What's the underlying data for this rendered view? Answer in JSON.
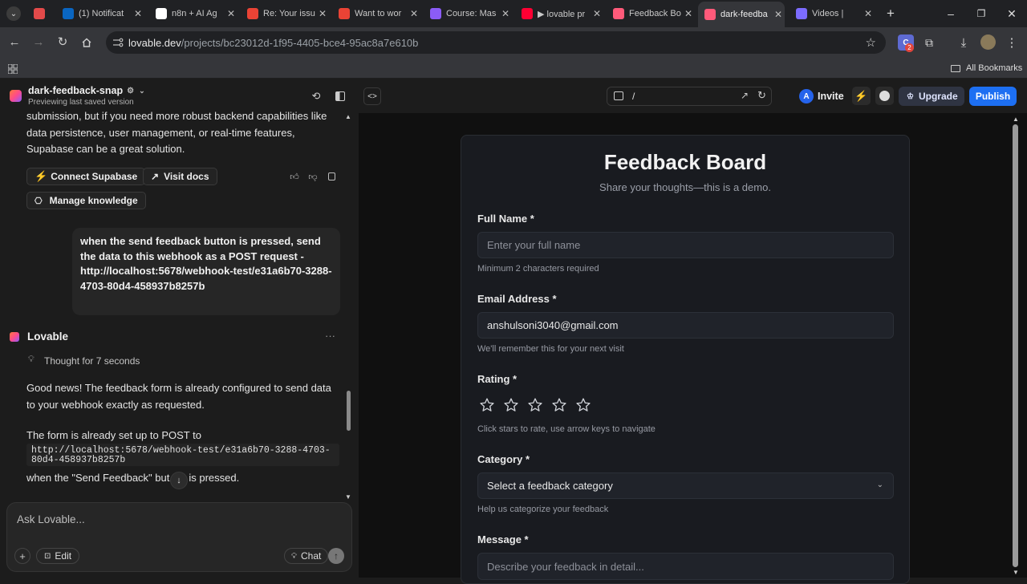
{
  "browser": {
    "tabs": [
      {
        "title": "",
        "favicon": "record-icon",
        "color": "#e34a4a"
      },
      {
        "title": "(1) Notificat",
        "favicon": "linkedin-icon",
        "color": "#0a66c2"
      },
      {
        "title": "n8n + AI Ag",
        "favicon": "plus-icon",
        "color": "#ffffff"
      },
      {
        "title": "Re: Your issu",
        "favicon": "gmail-icon",
        "color": "#ea4335"
      },
      {
        "title": "Want to wor",
        "favicon": "gmail-icon",
        "color": "#ea4335"
      },
      {
        "title": "Course: Mas",
        "favicon": "course-icon",
        "color": "#8b5cf6"
      },
      {
        "title": "▶ lovable pr",
        "favicon": "youtube-icon",
        "color": "#ff0033"
      },
      {
        "title": "Feedback Bo",
        "favicon": "lovable-icon",
        "color": "#ff5a7a"
      },
      {
        "title": "dark-feedba",
        "favicon": "lovable-icon",
        "color": "#ff5a7a"
      },
      {
        "title": "Videos |",
        "favicon": "gear-icon",
        "color": "#7c6cff"
      }
    ],
    "url_host": "lovable.dev",
    "url_path": "/projects/bc23012d-1f95-4405-bce4-95ac8a7e610b",
    "extension_badge": "2",
    "all_bookmarks": "All Bookmarks"
  },
  "project": {
    "name": "dark-feedback-snap",
    "status": "Previewing last saved version"
  },
  "chat": {
    "prev_text": "submission, but if you need more robust backend capabilities like data persistence, user management, or real-time features, Supabase can be a great solution.",
    "connect_supabase": "Connect Supabase",
    "visit_docs": "Visit docs",
    "manage_knowledge": "Manage knowledge",
    "user_message": "when the send feedback button is pressed, send the data to this webhook as a POST request - http://localhost:5678/webhook-test/e31a6b70-3288-4703-80d4-458937b8257b",
    "assistant_name": "Lovable",
    "thought": "Thought for 7 seconds",
    "reply_1": "Good news! The feedback form is already configured to send data to your webhook exactly as requested.",
    "reply_2": "The form is already set up to POST to",
    "code_1": "http://localhost:5678/webhook-test/e31a6b70-3288-4703-",
    "code_2": "80d4-458937b8257b",
    "reply_3a": "when the \"Send Feedback\" but",
    "reply_3b": "is pressed.",
    "input_placeholder": "Ask Lovable...",
    "edit_label": "Edit",
    "chat_label": "Chat"
  },
  "topbar": {
    "preview_path": "/",
    "avatar_letter": "A",
    "invite": "Invite",
    "upgrade": "Upgrade",
    "publish": "Publish"
  },
  "form": {
    "title": "Feedback Board",
    "subtitle": "Share your thoughts—this is a demo.",
    "name_label": "Full Name *",
    "name_placeholder": "Enter your full name",
    "name_help": "Minimum 2 characters required",
    "email_label": "Email Address *",
    "email_value": "anshulsoni3040@gmail.com",
    "email_help": "We'll remember this for your next visit",
    "rating_label": "Rating *",
    "rating_value": 0,
    "rating_max": 5,
    "rating_help": "Click stars to rate, use arrow keys to navigate",
    "category_label": "Category *",
    "category_value": "Select a feedback category",
    "category_help": "Help us categorize your feedback",
    "message_label": "Message *",
    "message_placeholder": "Describe your feedback in detail..."
  },
  "colors": {
    "accent_blue": "#1d6ff2",
    "supabase_green": "#3ecf8e",
    "lovable_pink": "#ff5a7a"
  }
}
